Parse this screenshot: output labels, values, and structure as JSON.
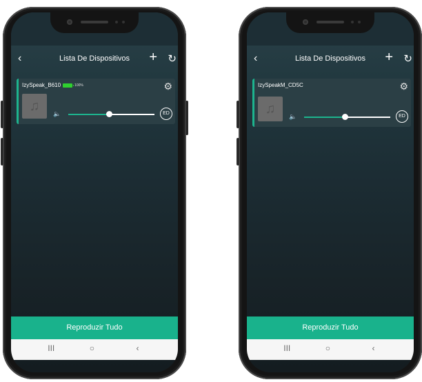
{
  "phones": [
    {
      "header": {
        "title": "Lista De Dispositivos",
        "back_icon": "‹",
        "add_icon": "+",
        "refresh_icon": "↻"
      },
      "device": {
        "name": "IzySpeak_B610",
        "battery_percent": "100%",
        "volume": 0.47,
        "ed_label": "ED",
        "settings_icon": "⚙",
        "volume_icon": "🔈",
        "music_icon": "♫"
      },
      "play_all_label": "Reproduzir Tudo",
      "nav": {
        "recent": "III",
        "home": "○",
        "back": "‹"
      }
    },
    {
      "header": {
        "title": "Lista De Dispositivos",
        "back_icon": "‹",
        "add_icon": "+",
        "refresh_icon": "↻"
      },
      "device": {
        "name": "IzySpeakM_CD5C",
        "volume": 0.47,
        "ed_label": "ED",
        "settings_icon": "⚙",
        "volume_icon": "🔈",
        "music_icon": "♫"
      },
      "play_all_label": "Reproduzir Tudo",
      "nav": {
        "recent": "III",
        "home": "○",
        "back": "‹"
      }
    }
  ],
  "colors": {
    "accent": "#19b28c",
    "battery": "#2fd12f",
    "card": "#2b3f45",
    "frame": "#141414"
  }
}
